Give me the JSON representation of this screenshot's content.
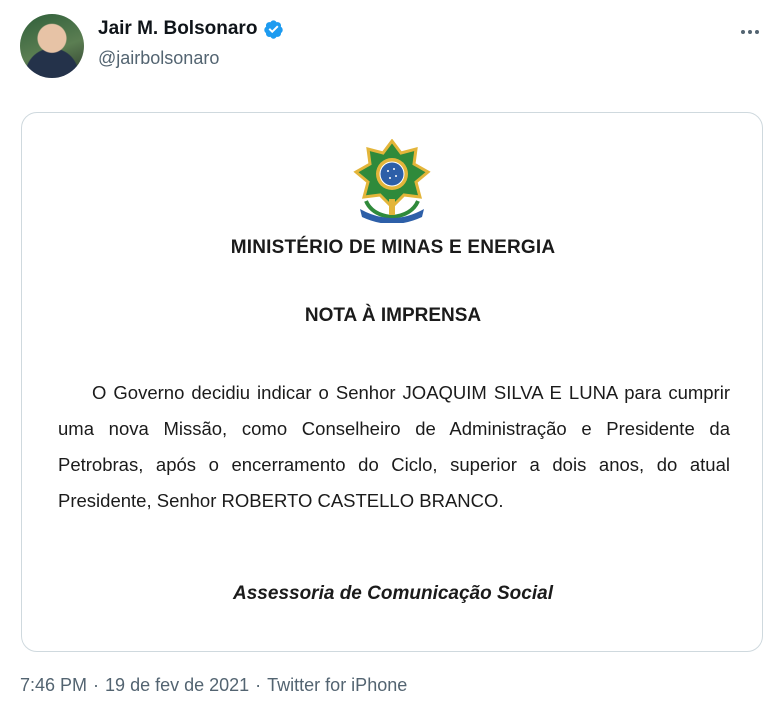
{
  "author": {
    "display_name": "Jair M. Bolsonaro",
    "handle": "@jairbolsonaro",
    "verified": true
  },
  "icons": {
    "verified": "verified-badge-icon",
    "more": "more-options-icon",
    "coat_of_arms": "brazil-coat-of-arms-icon"
  },
  "document": {
    "ministry": "MINISTÉRIO DE MINAS E ENERGIA",
    "title": "NOTA À IMPRENSA",
    "body": "O Governo decidiu indicar o Senhor JOAQUIM SILVA E LUNA para cumprir uma nova Missão, como Conselheiro de Administração e Presidente da Petrobras, após o encerramento do Ciclo, superior a dois anos, do atual Presidente, Senhor ROBERTO CASTELLO BRANCO.",
    "signature": "Assessoria de Comunicação Social"
  },
  "meta": {
    "time": "7:46 PM",
    "date": "19 de fev de 2021",
    "source": "Twitter for iPhone",
    "separator": "·"
  },
  "colors": {
    "verified_blue": "#1d9bf0",
    "secondary_text": "#536471",
    "card_border": "#cfd9de"
  }
}
